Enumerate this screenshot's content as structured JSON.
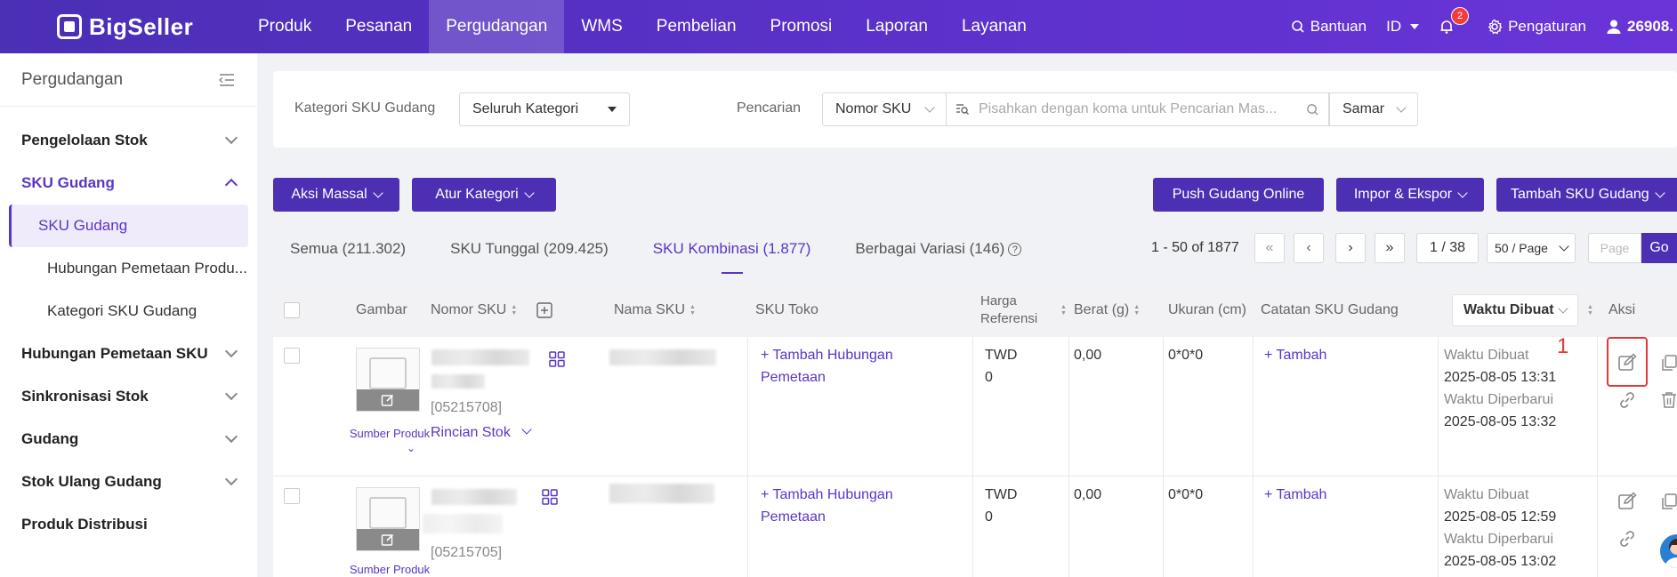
{
  "app": {
    "logo_text": "BigSeller"
  },
  "nav": {
    "items": [
      "Produk",
      "Pesanan",
      "Pergudangan",
      "WMS",
      "Pembelian",
      "Promosi",
      "Laporan",
      "Layanan"
    ],
    "active": "Pergudangan",
    "help": "Bantuan",
    "lang": "ID",
    "notif_count": "2",
    "settings": "Pengaturan",
    "user": "26908."
  },
  "sidebar": {
    "title": "Pergudangan",
    "items": [
      {
        "label": "Pengelolaan Stok"
      },
      {
        "label": "SKU Gudang",
        "open": true,
        "subs": [
          "SKU Gudang",
          "Hubungan Pemetaan Produ...",
          "Kategori SKU Gudang"
        ]
      },
      {
        "label": "Hubungan Pemetaan SKU"
      },
      {
        "label": "Sinkronisasi Stok"
      },
      {
        "label": "Gudang"
      },
      {
        "label": "Stok Ulang Gudang"
      },
      {
        "label": "Produk Distribusi"
      }
    ]
  },
  "filters": {
    "category_label": "Kategori SKU Gudang",
    "category_value": "Seluruh Kategori",
    "search_label": "Pencarian",
    "search_field": "Nomor SKU",
    "search_placeholder": "Pisahkan dengan koma untuk Pencarian Mas...",
    "match_mode": "Samar"
  },
  "toolbar": {
    "bulk_action": "Aksi Massal",
    "set_category": "Atur Kategori",
    "push_online": "Push Gudang Online",
    "import_export": "Impor & Ekspor",
    "add_sku": "Tambah SKU Gudang"
  },
  "tabs": [
    {
      "label": "Semua (211.302)"
    },
    {
      "label": "SKU Tunggal (209.425)"
    },
    {
      "label": "SKU Kombinasi (1.877)",
      "active": true
    },
    {
      "label": "Berbagai Variasi (146)"
    }
  ],
  "pagination": {
    "range": "1 - 50 of 1877",
    "page": "1 / 38",
    "page_size": "50 / Page",
    "goto_placeholder": "Page",
    "go": "Go"
  },
  "table": {
    "headers": {
      "image": "Gambar",
      "sku_no": "Nomor SKU",
      "sku_name": "Nama SKU",
      "store_sku": "SKU Toko",
      "ref_price_1": "Harga",
      "ref_price_2": "Referensi",
      "weight": "Berat (g)",
      "size": "Ukuran (cm)",
      "notes": "Catatan SKU Gudang",
      "time_select": "Waktu Dibuat",
      "action": "Aksi"
    },
    "rows": [
      {
        "source": "Sumber Produk",
        "sku_code": "[05215708]",
        "stock_detail": "Rincian Stok",
        "map_link_1": "+ Tambah Hubungan",
        "map_link_2": "Pemetaan",
        "currency": "TWD",
        "price": "0",
        "weight": "0,00",
        "size": "0*0*0",
        "note_add": "+ Tambah",
        "created_label": "Waktu Dibuat",
        "created": "2025-08-05 13:31",
        "updated_label": "Waktu Diperbarui",
        "updated": "2025-08-05 13:32",
        "annotation": "1"
      },
      {
        "source": "Sumber Produk",
        "sku_code": "[05215705]",
        "map_link_1": "+ Tambah Hubungan",
        "map_link_2": "Pemetaan",
        "currency": "TWD",
        "price": "0",
        "weight": "0,00",
        "size": "0*0*0",
        "note_add": "+ Tambah",
        "created_label": "Waktu Dibuat",
        "created": "2025-08-05 12:59",
        "updated_label": "Waktu Diperbarui",
        "updated": "2025-08-05 13:02"
      }
    ]
  },
  "colors": {
    "primary": "#4d2fb4",
    "accent": "#5b35c7",
    "highlight": "#e53935"
  }
}
